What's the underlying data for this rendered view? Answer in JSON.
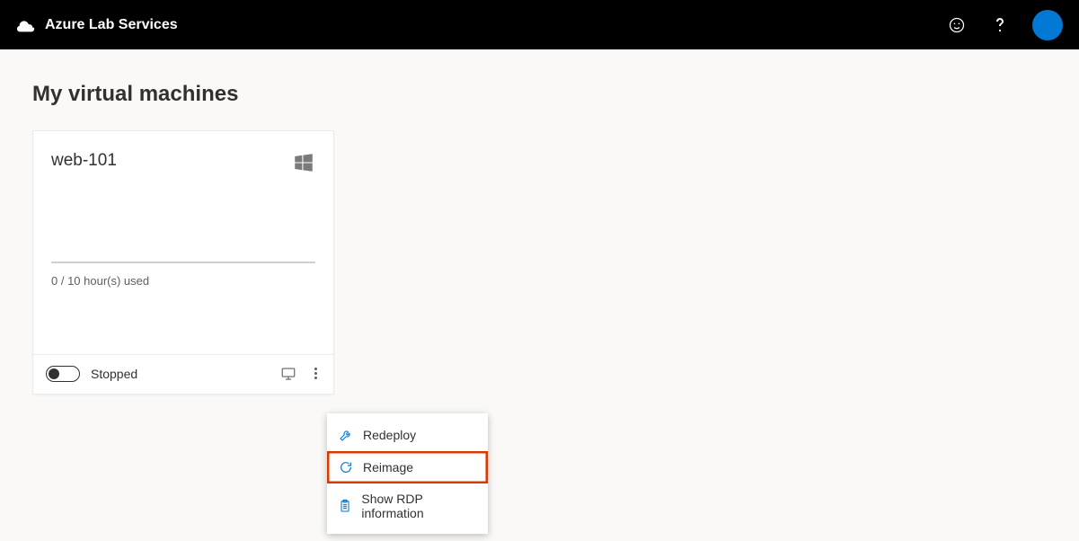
{
  "header": {
    "title": "Azure Lab Services"
  },
  "page": {
    "title": "My virtual machines"
  },
  "vm": {
    "name": "web-101",
    "os_icon": "windows",
    "hours_used": "0 / 10 hour(s) used",
    "status": "Stopped"
  },
  "menu": {
    "items": [
      {
        "icon": "wrench",
        "label": "Redeploy",
        "highlight": false
      },
      {
        "icon": "refresh",
        "label": "Reimage",
        "highlight": true
      },
      {
        "icon": "clipboard",
        "label": "Show RDP information",
        "highlight": false
      }
    ]
  }
}
